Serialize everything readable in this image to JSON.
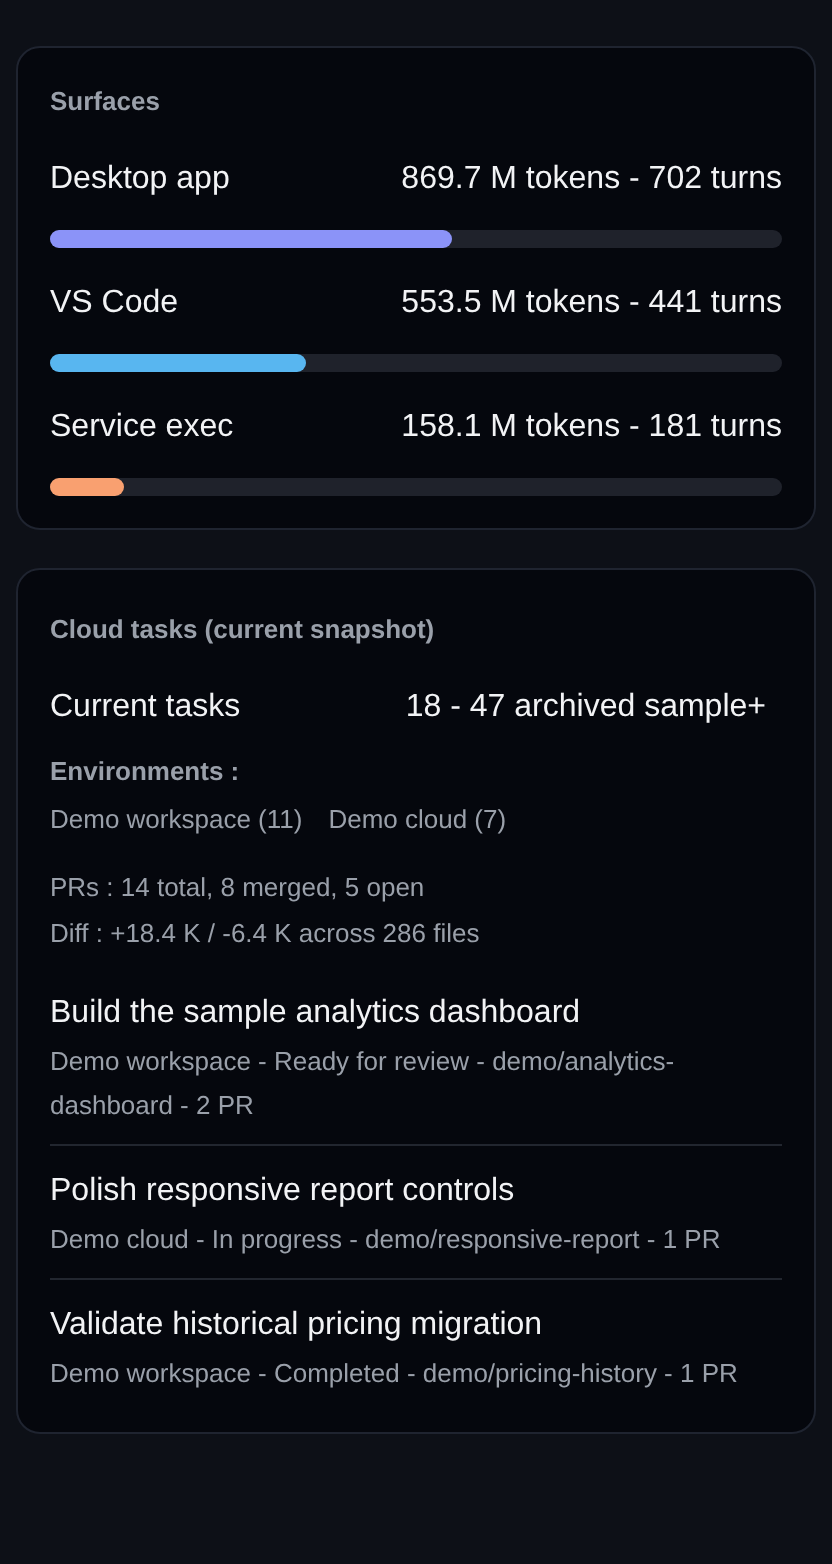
{
  "surfaces": {
    "title": "Surfaces",
    "items": [
      {
        "name": "Desktop app",
        "reading": "869.7 M tokens - 702 turns",
        "level": 0.55,
        "color": "#8b93f8"
      },
      {
        "name": "VS Code",
        "reading": "553.5 M tokens - 441 turns",
        "level": 0.35,
        "color": "#58b6f0"
      },
      {
        "name": "Service exec",
        "reading": "158.1 M tokens - 181 turns",
        "level": 0.1,
        "color": "#f9a070"
      }
    ]
  },
  "cloud_tasks": {
    "title": "Cloud tasks (current snapshot)",
    "current_label": "Current tasks",
    "current_value": "18 - 47 archived sample+",
    "environments_label": "Environments :",
    "environments": [
      "Demo workspace (11)",
      "Demo cloud (7)"
    ],
    "stats": [
      "PRs : 14 total, 8 merged, 5 open",
      "Diff : +18.4 K / -6.4 K across 286 files"
    ],
    "tasks": [
      {
        "title": "Build the sample analytics dashboard",
        "meta": "Demo workspace - Ready for review - demo/analytics-dashboard - 2 PR"
      },
      {
        "title": "Polish responsive report controls",
        "meta": "Demo cloud - In progress - demo/responsive-report - 1 PR"
      },
      {
        "title": "Validate historical pricing migration",
        "meta": "Demo workspace - Completed - demo/pricing-history - 1 PR"
      }
    ]
  }
}
